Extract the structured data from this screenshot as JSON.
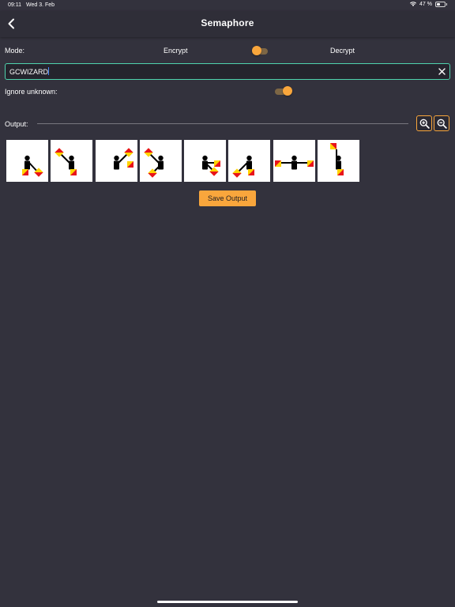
{
  "status_bar": {
    "time": "09:11",
    "date": "Wed 3. Feb",
    "battery_text": "47 %",
    "battery_level": 0.47
  },
  "app_bar": {
    "title": "Semaphore",
    "back_icon": "chevron-left-icon"
  },
  "mode": {
    "label": "Mode:",
    "encrypt_label": "Encrypt",
    "decrypt_label": "Decrypt",
    "selected": "Encrypt"
  },
  "input": {
    "value": "GCWIZARD",
    "clear_icon": "close-icon"
  },
  "ignore_unknown": {
    "label": "Ignore unknown:",
    "enabled": true
  },
  "output": {
    "label": "Output:",
    "zoom_in_icon": "zoom-in-icon",
    "zoom_out_icon": "zoom-out-icon",
    "letters": [
      "G",
      "C",
      "W",
      "I",
      "Z",
      "A",
      "R",
      "D"
    ]
  },
  "save_button": {
    "label": "Save Output"
  },
  "colors": {
    "background": "#33323d",
    "accent": "#f9a63c",
    "input_border": "#4fd3ad",
    "flag_red": "#e8141c",
    "flag_yellow": "#ffd400"
  }
}
